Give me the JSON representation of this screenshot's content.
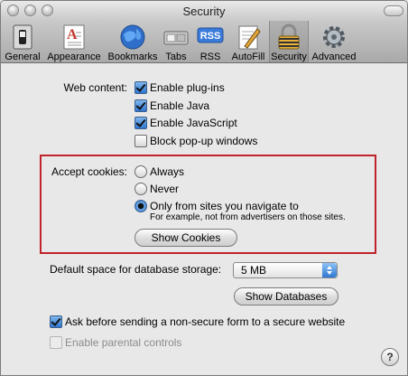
{
  "window": {
    "title": "Security"
  },
  "toolbar": {
    "items": [
      {
        "label": "General",
        "icon": "general-switch-icon"
      },
      {
        "label": "Appearance",
        "icon": "appearance-icon"
      },
      {
        "label": "Bookmarks",
        "icon": "globe-icon"
      },
      {
        "label": "Tabs",
        "icon": "tabs-icon"
      },
      {
        "label": "RSS",
        "icon": "rss-icon",
        "badge": "RSS"
      },
      {
        "label": "AutoFill",
        "icon": "autofill-icon"
      },
      {
        "label": "Security",
        "icon": "lock-icon",
        "selected": true
      },
      {
        "label": "Advanced",
        "icon": "gear-icon"
      }
    ]
  },
  "web_content": {
    "label": "Web content:",
    "options": [
      {
        "label": "Enable plug-ins",
        "checked": true
      },
      {
        "label": "Enable Java",
        "checked": true
      },
      {
        "label": "Enable JavaScript",
        "checked": true
      },
      {
        "label": "Block pop-up windows",
        "checked": false
      }
    ]
  },
  "cookies": {
    "label": "Accept cookies:",
    "options": [
      {
        "label": "Always",
        "selected": false
      },
      {
        "label": "Never",
        "selected": false
      },
      {
        "label": "Only from sites you navigate to",
        "selected": true
      }
    ],
    "note": "For example, not from advertisers on those sites.",
    "show_button": "Show Cookies"
  },
  "database": {
    "label": "Default space for database storage:",
    "value": "5 MB",
    "show_button": "Show Databases"
  },
  "ask_nonsecure": {
    "label": "Ask before sending a non-secure form to a secure website",
    "checked": true
  },
  "parental": {
    "label": "Enable parental controls",
    "checked": false,
    "enabled": false
  },
  "help": {
    "glyph": "?"
  },
  "colors": {
    "highlight_border": "#c0232a",
    "accent_blue": "#2f78d2"
  }
}
